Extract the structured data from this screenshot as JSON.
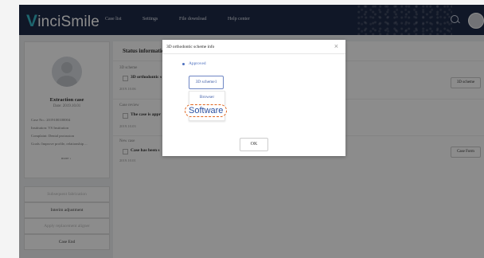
{
  "nav": {
    "logo_v": "V",
    "logo_rest": "inciSmile",
    "links": [
      "Case list",
      "Settings",
      "File download",
      "Help center"
    ]
  },
  "left": {
    "case_title": "Extraction case",
    "case_date": "Date: 2019.10.01",
    "info": [
      "Case No.: 2019100100004",
      "Institution: VS Institution",
      "Complaint: Dental protrusion",
      "Goals: Improve profile, relationship ...",
      "more ›"
    ],
    "buttons": [
      {
        "label": "Subsequent fabrication",
        "disabled": true
      },
      {
        "label": "Interim adjustment",
        "disabled": false
      },
      {
        "label": "Apply replacement aligner",
        "disabled": true
      },
      {
        "label": "Case End",
        "disabled": false
      }
    ]
  },
  "main": {
    "title": "Status informatio",
    "sections": [
      {
        "heading": "3D scheme",
        "row": "3D orthodontic s",
        "date": "2019.10.06",
        "button": "3D scheme"
      },
      {
        "heading": "Case review",
        "row": "The case is appr",
        "date": "2019.10.03",
        "button": ""
      },
      {
        "heading": "New case",
        "row": "Case has been s",
        "date": "2019.10.01",
        "button": "Case Form"
      }
    ]
  },
  "dialog": {
    "title": "3D orthodontic scheme info",
    "close": "×",
    "status": "Approved",
    "scheme_button": "3D scheme1",
    "options": [
      "Browser",
      "Software"
    ],
    "ok": "OK"
  },
  "colors": {
    "navbar": "#1e2a47",
    "logo_accent": "#37b9c9",
    "link_blue": "#3b5aa6",
    "highlight": "#e0641e"
  }
}
